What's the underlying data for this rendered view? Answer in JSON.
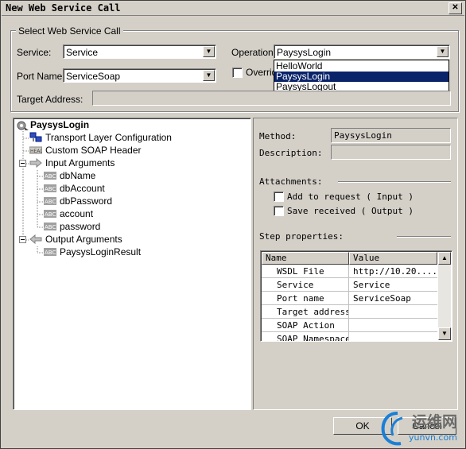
{
  "window": {
    "title": "New Web Service Call",
    "close_glyph": "✕"
  },
  "select_group": {
    "title": "Select Web Service Call",
    "service_label": "Service:",
    "service_value": "Service",
    "port_label": "Port Name:",
    "port_value": "ServiceSoap",
    "operation_label": "Operation:",
    "operation_value": "PaysysLogin",
    "operation_options": [
      "HelloWorld",
      "PaysysLogin",
      "PaysysLogout"
    ],
    "override_label": "Overrid",
    "target_address_label": "Target Address:"
  },
  "tree": {
    "root": "PaysysLogin",
    "items": [
      {
        "label": "Transport Layer Configuration",
        "icon": "network-icon"
      },
      {
        "label": "Custom SOAP Header",
        "icon": "head-icon"
      },
      {
        "label": "Input Arguments",
        "icon": "arrow-right-icon"
      },
      {
        "label": "dbName",
        "icon": "abc-icon"
      },
      {
        "label": "dbAccount",
        "icon": "abc-icon"
      },
      {
        "label": "dbPassword",
        "icon": "abc-icon"
      },
      {
        "label": "account",
        "icon": "abc-icon"
      },
      {
        "label": "password",
        "icon": "abc-icon"
      },
      {
        "label": "Output Arguments",
        "icon": "arrow-left-icon"
      },
      {
        "label": "PaysysLoginResult",
        "icon": "abc-icon"
      }
    ]
  },
  "details": {
    "method_label": "Method:",
    "method_value": "PaysysLogin",
    "description_label": "Description:",
    "attachments_label": "Attachments:",
    "add_to_request": "Add to request ( Input )",
    "save_received": "Save received ( Output )",
    "step_properties_label": "Step properties:"
  },
  "grid": {
    "headers": [
      "Name",
      "Value"
    ],
    "rows": [
      [
        "WSDL File",
        "http://10.20...."
      ],
      [
        "Service",
        "Service"
      ],
      [
        "Port name",
        "ServiceSoap"
      ],
      [
        "Target address",
        ""
      ],
      [
        "SOAP Action",
        ""
      ],
      [
        "SOAP Namespace",
        ""
      ]
    ]
  },
  "buttons": {
    "ok": "OK",
    "cancel": "Cancel"
  },
  "watermark": {
    "text1": "运维网",
    "text2": "yunvn.com"
  }
}
